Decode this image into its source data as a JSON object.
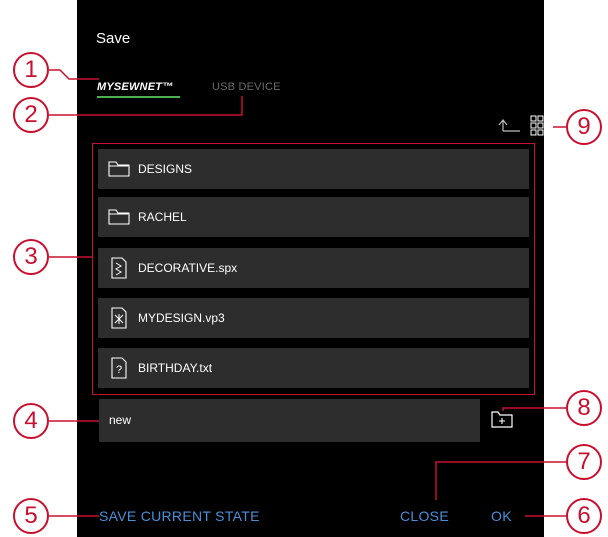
{
  "dialog": {
    "title": "Save",
    "tabs": [
      {
        "label": "MYSEWNET™",
        "active": true
      },
      {
        "label": "USB DEVICE",
        "active": false
      }
    ],
    "files": [
      {
        "name": "DESIGNS",
        "icon": "folder-icon"
      },
      {
        "name": "RACHEL",
        "icon": "folder-icon"
      },
      {
        "name": "DECORATIVE.spx",
        "icon": "stitch-file-icon"
      },
      {
        "name": "MYDESIGN.vp3",
        "icon": "embroidery-file-icon"
      },
      {
        "name": "BIRTHDAY.txt",
        "icon": "unknown-file-icon"
      }
    ],
    "filename_value": "new",
    "buttons": {
      "save_current_state": "SAVE CURRENT STATE",
      "close": "CLOSE",
      "ok": "OK"
    },
    "toolbar_icons": [
      "parent-folder-icon",
      "grid-view-icon",
      "new-folder-icon"
    ]
  },
  "callouts": [
    "1",
    "2",
    "3",
    "4",
    "5",
    "6",
    "7",
    "8",
    "9"
  ],
  "colors": {
    "callout": "#c8102e",
    "action_text": "#4a90d9",
    "active_tab_underline": "#4caf50",
    "screen_bg": "#000000",
    "row_bg": "#2d2d2d"
  }
}
